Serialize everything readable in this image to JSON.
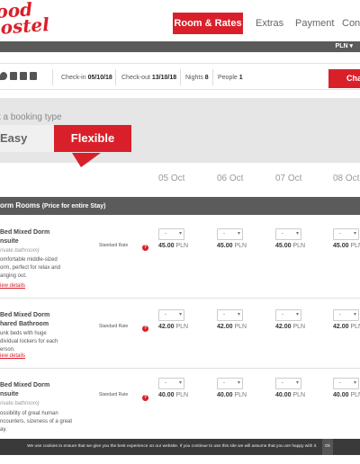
{
  "header": {
    "logo_line1": "ood",
    "logo_line2": "ostel",
    "nav": [
      "Room & Rates",
      "Extras",
      "Payment",
      "Conf"
    ],
    "currency": "PLN ▾"
  },
  "info": {
    "checkin_label": "Check-in",
    "checkin_value": "05/10/18",
    "checkout_label": "Check-out",
    "checkout_value": "13/10/18",
    "nights_label": "Nights",
    "nights_value": "8",
    "people_label": "People",
    "people_value": "1",
    "change_label": "Cha"
  },
  "booking_type": {
    "label": "t a booking type",
    "easy": "Easy",
    "flexible": "Flexible"
  },
  "dates": [
    "05 Oct",
    "06 Oct",
    "07 Oct",
    "08 Oct"
  ],
  "section": {
    "title": "orm Rooms",
    "subtitle": "(Price for entire Stay)"
  },
  "rooms": [
    {
      "name1": "Bed Mixed Dorm",
      "name2": "nsuite",
      "sub": "rivate bathroom)",
      "desc": [
        "omfortable middle-sized",
        "orm, perfect for relax and",
        "anging out."
      ],
      "link": "iew details",
      "rate": "Standard Rate",
      "qty": "-",
      "prices": [
        "45.00",
        "45.00",
        "45.00",
        "45.00"
      ],
      "currency": "PLN"
    },
    {
      "name1": "Bed Mixed Dorm",
      "name2": "hared Bathroom",
      "sub": "",
      "desc": [
        "unk beds with huge",
        "dividual lockers for each",
        "erson."
      ],
      "link": "iew details",
      "rate": "Standard Rate",
      "qty": "-",
      "prices": [
        "42.00",
        "42.00",
        "42.00",
        "42.00"
      ],
      "currency": "PLN"
    },
    {
      "name1": "Bed Mixed Dorm",
      "name2": "nsuite",
      "sub": "rivate bathroom)",
      "desc": [
        "ossibility of great human",
        "ncounters, sizeness of a great",
        "ay."
      ],
      "link": "",
      "rate": "Standard Rate",
      "qty": "-",
      "prices": [
        "40.00",
        "40.00",
        "40.00",
        "40.00"
      ],
      "currency": "PLN"
    }
  ],
  "cookie": {
    "text": "We use cookies to ensure that we give you the best experience on our website. If you continue to use this site we will assume that you are happy with it.",
    "ok": "Ok"
  },
  "colors": {
    "accent": "#d9202a",
    "dark_bar": "#5b5b5b",
    "panel": "#e6e6e6"
  }
}
